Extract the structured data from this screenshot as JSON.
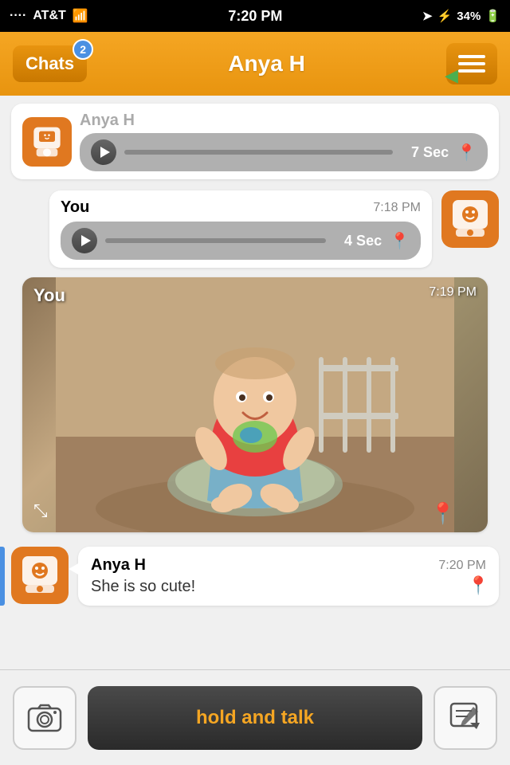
{
  "status_bar": {
    "carrier": "AT&T",
    "time": "7:20 PM",
    "battery": "34%"
  },
  "header": {
    "chats_label": "Chats",
    "badge_count": "2",
    "title": "Anya H"
  },
  "messages": [
    {
      "id": "msg-partial-top",
      "type": "audio_partial",
      "sender": "Anya H",
      "duration": "7 Sec",
      "has_pin": true
    },
    {
      "id": "msg-audio-you",
      "type": "audio",
      "sender": "You",
      "time": "7:18 PM",
      "duration": "4 Sec",
      "has_pin": true,
      "outgoing": true
    },
    {
      "id": "msg-image-you",
      "type": "image",
      "sender": "You",
      "time": "7:19 PM",
      "outgoing": true
    },
    {
      "id": "msg-text-anya",
      "type": "text",
      "sender": "Anya H",
      "time": "7:20 PM",
      "text": "She is so cute!",
      "outgoing": false
    }
  ],
  "bottom_bar": {
    "ptt_label": "hold and talk"
  }
}
